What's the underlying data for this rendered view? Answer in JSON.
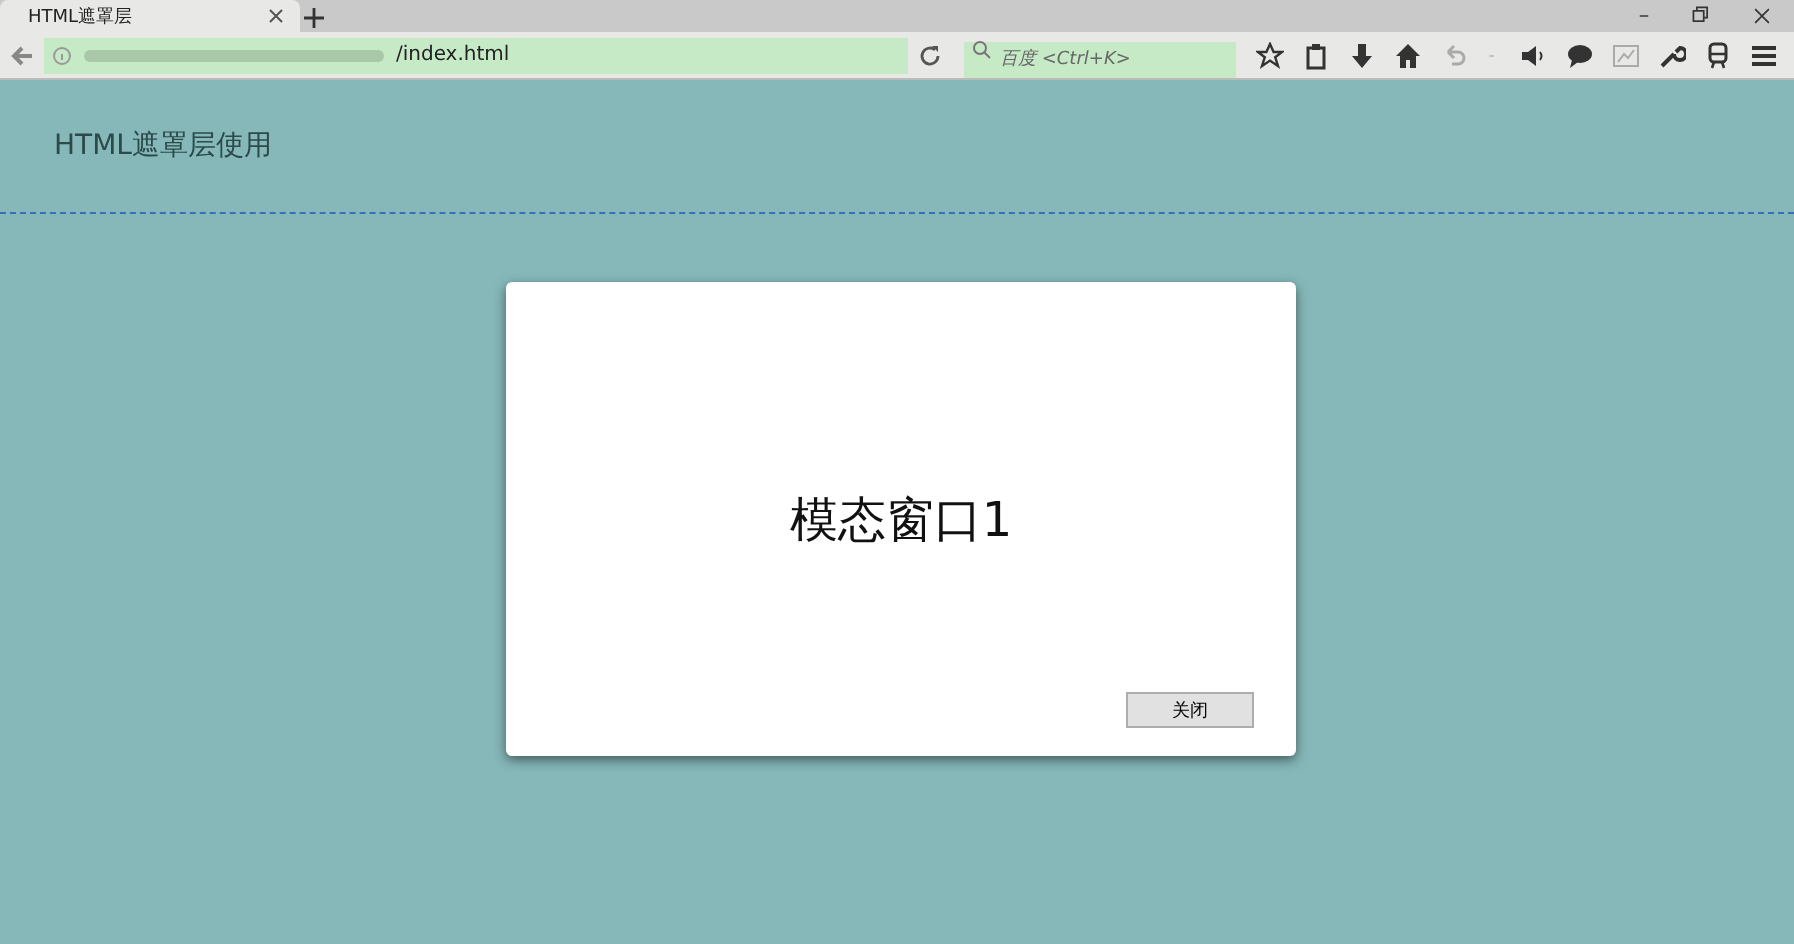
{
  "browser": {
    "tab": {
      "title": "HTML遮罩层",
      "selected": true
    },
    "address": "/index.html",
    "search": {
      "placeholder": "百度 <Ctrl+K>"
    }
  },
  "page": {
    "heading": "HTML遮罩层使用"
  },
  "modal": {
    "title": "模态窗口1",
    "buttons": [
      "关闭"
    ]
  }
}
